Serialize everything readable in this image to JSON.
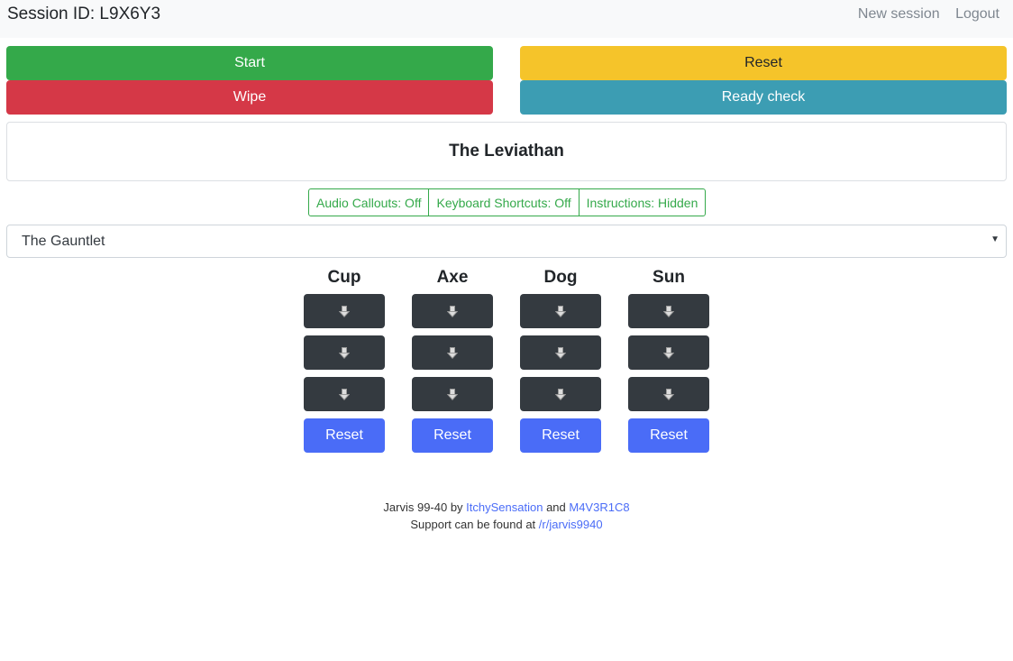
{
  "header": {
    "session_label": "Session ID: L9X6Y3",
    "new_session": "New session",
    "logout": "Logout"
  },
  "controls": {
    "start": "Start",
    "reset": "Reset",
    "wipe": "Wipe",
    "ready_check": "Ready check"
  },
  "raid_title": "The Leviathan",
  "toggles": {
    "audio": "Audio Callouts: Off",
    "keyboard": "Keyboard Shortcuts: Off",
    "instructions": "Instructions: Hidden"
  },
  "encounter_select": {
    "selected": "The Gauntlet"
  },
  "columns": [
    {
      "title": "Cup",
      "slot_icon": "down-arrow-icon",
      "reset": "Reset"
    },
    {
      "title": "Axe",
      "slot_icon": "down-arrow-icon",
      "reset": "Reset"
    },
    {
      "title": "Dog",
      "slot_icon": "down-arrow-icon",
      "reset": "Reset"
    },
    {
      "title": "Sun",
      "slot_icon": "down-arrow-icon",
      "reset": "Reset"
    }
  ],
  "footer": {
    "line1_prefix": "Jarvis 99-40 by ",
    "author1": "ItchySensation",
    "and": " and ",
    "author2": "M4V3R1C8",
    "line2_prefix": "Support can be found at ",
    "support_link": "/r/jarvis9940"
  },
  "colors": {
    "start": "#34a94a",
    "reset": "#f5c42a",
    "wipe": "#d53847",
    "ready_check": "#3c9db3",
    "slot": "#343a40",
    "column_reset": "#4a6cf7"
  }
}
